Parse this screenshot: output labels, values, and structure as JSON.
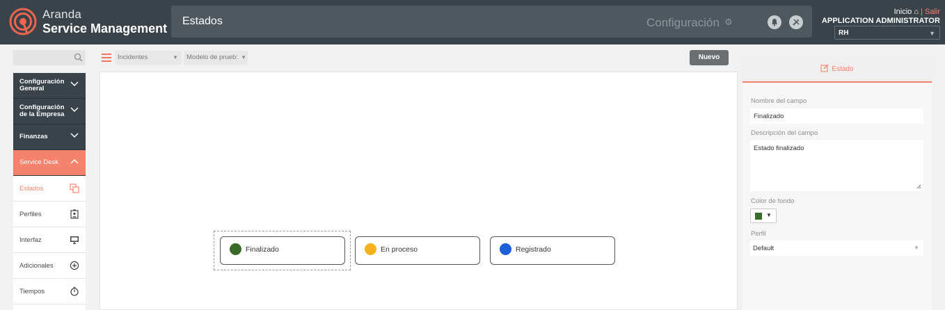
{
  "header": {
    "brand_top": "Aranda",
    "brand_bottom": "Service Management",
    "page_title": "Estados",
    "config_label": "Configuración",
    "links": {
      "inicio": "Inicio",
      "separator": "|",
      "salir": "Salir"
    },
    "user_name": "APPLICATION ADMINISTRATOR",
    "company": "RH"
  },
  "sidebar": {
    "groups": [
      {
        "label": "Configuración General"
      },
      {
        "label": "Configuración de la Empresa"
      },
      {
        "label": "Finanzas"
      },
      {
        "label": "Service Desk"
      }
    ],
    "items": [
      {
        "label": "Estados",
        "icon": "copy-icon"
      },
      {
        "label": "Perfiles",
        "icon": "badge-icon"
      },
      {
        "label": "Interfaz",
        "icon": "monitor-icon"
      },
      {
        "label": "Adicionales",
        "icon": "add-circle-icon"
      },
      {
        "label": "Tiempos",
        "icon": "stopwatch-icon"
      }
    ]
  },
  "toolbar": {
    "type_dropdown": "Incidentes",
    "model_dropdown": "Modelo de prueb:",
    "new_button": "Nuevo"
  },
  "canvas": {
    "nodes": [
      {
        "label": "Finalizado",
        "color": "#3b6b2a",
        "selected": true
      },
      {
        "label": "En proceso",
        "color": "#f5b21e",
        "selected": false
      },
      {
        "label": "Registrado",
        "color": "#1d5fd8",
        "selected": false
      }
    ]
  },
  "panel": {
    "tab_label": "Estado",
    "name_label": "Nombre del campo",
    "name_value": "Finalizado",
    "desc_label": "Descripción del campo",
    "desc_value": "Estado finalizado",
    "bgcolor_label": "Color de fondo",
    "bgcolor_value": "#3b6b2a",
    "profile_label": "Perfil",
    "profile_value": "Default"
  }
}
